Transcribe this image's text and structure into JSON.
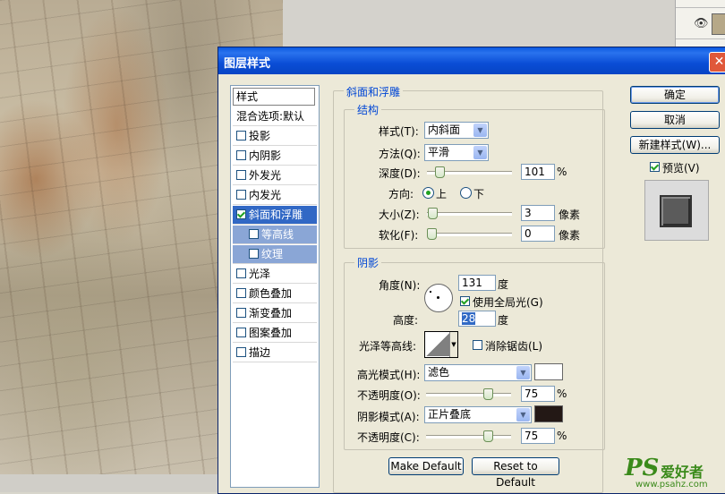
{
  "dialog": {
    "title": "图层样式",
    "close_icon": "close-icon"
  },
  "styles_panel": {
    "header": "样式",
    "items": [
      {
        "label": "混合选项:默认",
        "checkbox": false
      },
      {
        "label": "投影",
        "checkbox": true,
        "checked": false
      },
      {
        "label": "内阴影",
        "checkbox": true,
        "checked": false
      },
      {
        "label": "外发光",
        "checkbox": true,
        "checked": false
      },
      {
        "label": "内发光",
        "checkbox": true,
        "checked": false
      },
      {
        "label": "斜面和浮雕",
        "checkbox": true,
        "checked": true,
        "selected": true
      },
      {
        "label": "等高线",
        "checkbox": true,
        "checked": false,
        "sub": true
      },
      {
        "label": "纹理",
        "checkbox": true,
        "checked": false,
        "sub": true
      },
      {
        "label": "光泽",
        "checkbox": true,
        "checked": false
      },
      {
        "label": "颜色叠加",
        "checkbox": true,
        "checked": false
      },
      {
        "label": "渐变叠加",
        "checkbox": true,
        "checked": false
      },
      {
        "label": "图案叠加",
        "checkbox": true,
        "checked": false
      },
      {
        "label": "描边",
        "checkbox": true,
        "checked": false
      }
    ]
  },
  "bevel": {
    "group_title": "斜面和浮雕",
    "structure_title": "结构",
    "style_label": "样式(T):",
    "style_value": "内斜面",
    "technique_label": "方法(Q):",
    "technique_value": "平滑",
    "depth_label": "深度(D):",
    "depth_value": "101",
    "depth_unit": "%",
    "depth_level": 0.1,
    "direction_label": "方向:",
    "direction_up": "上",
    "direction_down": "下",
    "size_label": "大小(Z):",
    "size_value": "3",
    "size_unit": "像素",
    "size_level": 0.01,
    "soften_label": "软化(F):",
    "soften_value": "0",
    "soften_unit": "像素",
    "soften_level": 0
  },
  "shading": {
    "title": "阴影",
    "angle_label": "角度(N):",
    "angle_value": "131",
    "angle_unit": "度",
    "global_light_label": "使用全局光(G)",
    "altitude_label": "高度:",
    "altitude_value": "28",
    "altitude_unit": "度",
    "gloss_contour_label": "光泽等高线:",
    "antialias_label": "消除锯齿(L)",
    "highlight_mode_label": "高光模式(H):",
    "highlight_mode_value": "滤色",
    "highlight_color": "#ffffff",
    "highlight_opacity_label": "不透明度(O):",
    "highlight_opacity_value": "75",
    "highlight_opacity_unit": "%",
    "highlight_opacity_level": 0.75,
    "shadow_mode_label": "阴影模式(A):",
    "shadow_mode_value": "正片叠底",
    "shadow_color": "#231815",
    "shadow_opacity_label": "不透明度(C):",
    "shadow_opacity_value": "75",
    "shadow_opacity_unit": "%",
    "shadow_opacity_level": 0.75
  },
  "buttons": {
    "ok": "确定",
    "cancel": "取消",
    "new_style": "新建样式(W)...",
    "preview": "预览(V)",
    "make_default": "Make Default",
    "reset_default": "Reset to Default"
  },
  "watermark": {
    "brand": "PS",
    "text": "爱好者",
    "url": "www.psahz.com"
  }
}
